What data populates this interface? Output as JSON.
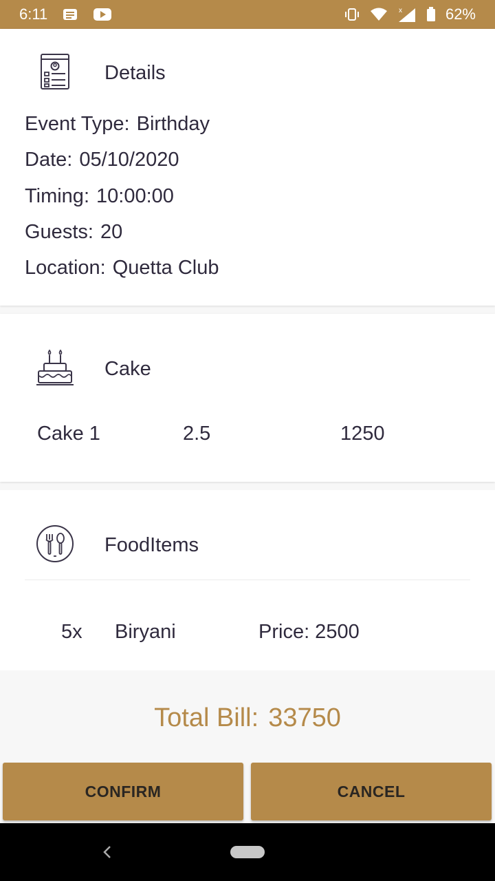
{
  "status_bar": {
    "time": "6:11",
    "battery": "62%"
  },
  "details": {
    "title": "Details",
    "event_type_label": "Event Type:",
    "event_type_value": "Birthday",
    "date_label": "Date:",
    "date_value": "05/10/2020",
    "timing_label": "Timing:",
    "timing_value": "10:00:00",
    "guests_label": "Guests:",
    "guests_value": "20",
    "location_label": "Location:",
    "location_value": "Quetta Club"
  },
  "cake": {
    "title": "Cake",
    "items": [
      {
        "name": "Cake 1",
        "weight": "2.5",
        "price": "1250"
      }
    ]
  },
  "food": {
    "title": "FoodItems",
    "items": [
      {
        "qty": "5x",
        "name": "Biryani",
        "price": "Price: 2500"
      }
    ]
  },
  "total": {
    "label": "Total Bill:",
    "value": "33750"
  },
  "actions": {
    "confirm": "CONFIRM",
    "cancel": "CANCEL"
  },
  "colors": {
    "accent": "#b58a4a",
    "text": "#2f2a3d",
    "background": "#f7f7f7"
  },
  "icons": [
    "document-icon",
    "notes-icon",
    "youtube-icon",
    "vibrate-icon",
    "wifi-icon",
    "signal-icon",
    "battery-icon",
    "cake-icon",
    "cutlery-icon",
    "back-icon",
    "home-icon"
  ]
}
